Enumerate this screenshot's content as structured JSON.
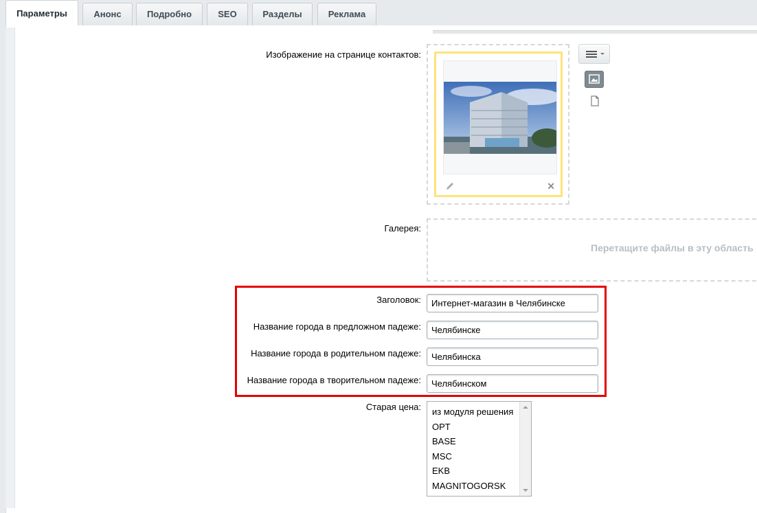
{
  "tabs": [
    {
      "label": "Параметры",
      "active": true
    },
    {
      "label": "Анонс",
      "active": false
    },
    {
      "label": "Подробно",
      "active": false
    },
    {
      "label": "SEO",
      "active": false
    },
    {
      "label": "Разделы",
      "active": false
    },
    {
      "label": "Реклама",
      "active": false
    }
  ],
  "contact_image": {
    "label": "Изображение на странице контактов:"
  },
  "gallery": {
    "label": "Галерея:",
    "drop_text": "Перетащите файлы в эту область"
  },
  "fields": {
    "heading": {
      "label": "Заголовок:",
      "value": "Интернет-магазин в Челябинске"
    },
    "city_prepositional": {
      "label": "Название города в предложном падеже:",
      "value": "Челябинске"
    },
    "city_genitive": {
      "label": "Название города в родительном падеже:",
      "value": "Челябинска"
    },
    "city_instrumental": {
      "label": "Название города в творительном падеже:",
      "value": "Челябинском"
    }
  },
  "old_price": {
    "label": "Старая цена:",
    "options": [
      "из модуля решения",
      "OPT",
      "BASE",
      "MSC",
      "EKB",
      "MAGNITOGORSK"
    ]
  },
  "colors": {
    "highlight": "#e40000",
    "image_border": "#ffe27a"
  },
  "icons": [
    "menu-icon",
    "image-icon",
    "file-icon",
    "pencil-icon",
    "close-icon",
    "arrow-up-icon",
    "arrow-down-icon"
  ]
}
